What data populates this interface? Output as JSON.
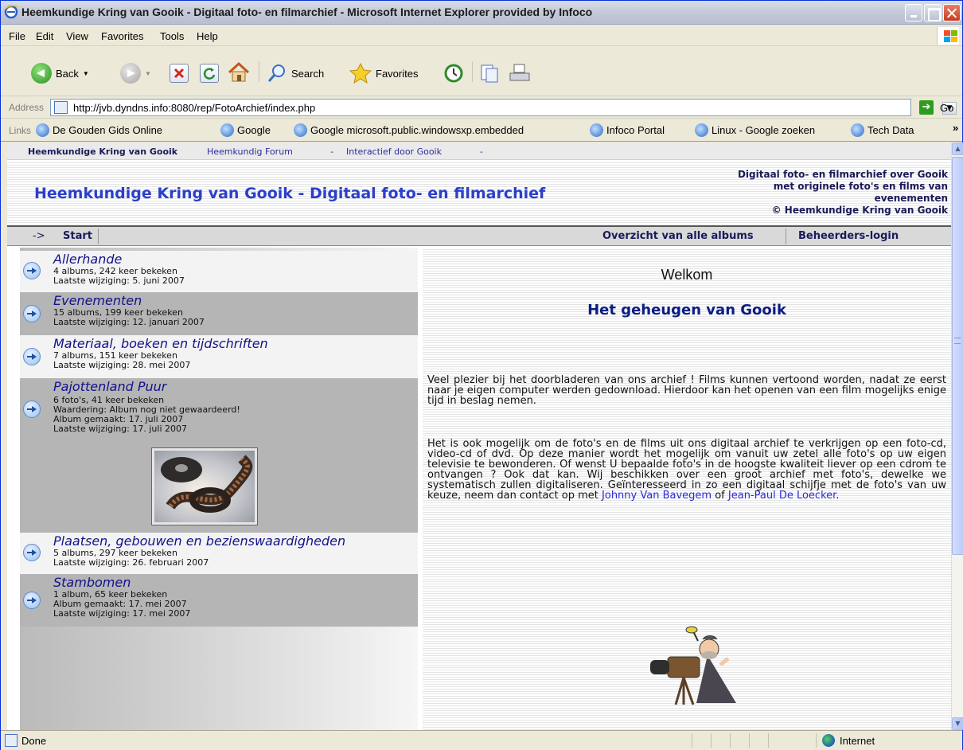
{
  "window": {
    "title": "Heemkundige Kring van Gooik - Digitaal foto- en filmarchief - Microsoft Internet Explorer provided by Infoco"
  },
  "menu": [
    "File",
    "Edit",
    "View",
    "Favorites",
    "Tools",
    "Help"
  ],
  "toolbar": {
    "back_label": "Back",
    "search_label": "Search",
    "favorites_label": "Favorites"
  },
  "address": {
    "label": "Address",
    "url": "http://jvb.dyndns.info:8080/rep/FotoArchief/index.php",
    "go_label": "Go"
  },
  "links": {
    "label": "Links",
    "items": [
      "De Gouden Gids Online",
      "Google",
      "Google microsoft.public.windowsxp.embedded",
      "Infoco Portal",
      "Linux - Google zoeken",
      "Tech Data"
    ],
    "more": "»"
  },
  "page": {
    "topnav": {
      "org": "Heemkundige Kring van Gooik",
      "forum": "Heemkundig Forum",
      "sep1": "-",
      "interactief": "Interactief door Gooik",
      "sep2": "-"
    },
    "title": "Heemkundige Kring van Gooik - Digitaal foto- en filmarchief",
    "description_lines": [
      "Digitaal foto- en filmarchief over Gooik",
      "met originele foto's en films van",
      "evenementen",
      "© Heemkundige Kring van Gooik"
    ],
    "breadcrumb": {
      "arrow": "->",
      "start": "Start"
    },
    "nav": {
      "albums": "Overzicht van alle albums",
      "login": "Beheerders-login"
    },
    "categories": [
      {
        "name": "Allerhande",
        "lines": [
          "4 albums, 242 keer bekeken",
          "Laatste wijziging: 5. juni 2007"
        ]
      },
      {
        "name": "Evenementen",
        "lines": [
          "15 albums, 199 keer bekeken",
          "Laatste wijziging: 12. januari 2007"
        ]
      },
      {
        "name": "Materiaal, boeken en tijdschriften",
        "lines": [
          "7 albums, 151 keer bekeken",
          "Laatste wijziging: 28. mei 2007"
        ]
      },
      {
        "name": "Pajottenland Puur",
        "lines": [
          "6 foto's, 41 keer bekeken",
          "Waardering: Album nog niet gewaardeerd!",
          "Album gemaakt: 17. juli 2007",
          "Laatste wijziging: 17. juli 2007"
        ]
      },
      {
        "name": "Plaatsen, gebouwen en bezienswaardigheden",
        "lines": [
          "5 albums, 297 keer bekeken",
          "Laatste wijziging: 26. februari 2007"
        ]
      },
      {
        "name": "Stambomen",
        "lines": [
          "1 album, 65 keer bekeken",
          "Album gemaakt: 17. mei 2007",
          "Laatste wijziging: 17. mei 2007"
        ]
      }
    ],
    "welcome": "Welkom",
    "tagline": "Het geheugen van Gooik",
    "intro": "Veel plezier bij het doorbladeren van ons archief ! Films kunnen vertoond worden, nadat ze eerst naar je eigen computer werden gedownload. Hierdoor kan het openen van een film mogelijks enige tijd in beslag nemen.",
    "body_text": "Het is ook mogelijk om de foto's en de films uit ons digitaal archief te verkrijgen op een foto-cd, video-cd of dvd. Op deze manier wordt het mogelijk om vanuit uw zetel alle foto's op uw eigen televisie te bewonderen. Of wenst U bepaalde foto's in de hoogste kwaliteit liever op een cdrom te ontvangen ? Ook dat kan. Wij beschikken over een groot archief met foto's, dewelke we systematisch zullen digitaliseren. Geïnteresseerd in zo een digitaal schijfje met de foto's van uw keuze, neem dan contact op met",
    "contact1": "Johnny Van Bavegem",
    "or": "of",
    "contact2": "Jean-Paul De Loecker",
    "end": "."
  },
  "status": {
    "text": "Done",
    "zone": "Internet"
  },
  "colors": {
    "title_blue": "#2b3fc9",
    "link_blue": "#2a2ad0",
    "category_navy": "#12128a"
  }
}
